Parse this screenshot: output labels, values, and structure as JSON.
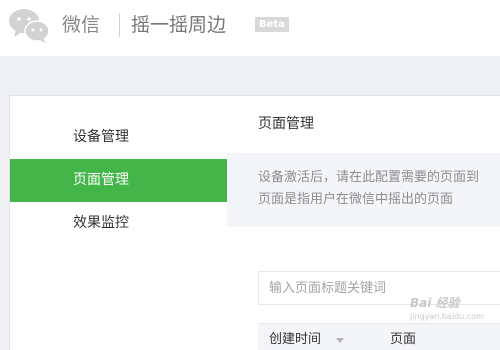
{
  "header": {
    "brand": "微信",
    "app_title": "摇一摇周边",
    "badge": "Beta"
  },
  "sidebar": {
    "items": [
      {
        "label": "设备管理",
        "active": false
      },
      {
        "label": "页面管理",
        "active": true
      },
      {
        "label": "效果监控",
        "active": false
      }
    ]
  },
  "main": {
    "title": "页面管理",
    "notice_line1": "设备激活后，请在此配置需要的页面到",
    "notice_line2": "页面是指用户在微信中摇出的页面",
    "search_placeholder": "输入页面标题关键词",
    "columns": [
      "创建时间",
      "页面"
    ]
  },
  "watermark": {
    "text": "Bai 经验",
    "sub": "jingyan.baidu.com"
  },
  "colors": {
    "accent": "#44b549",
    "header_bg": "#ffffff",
    "page_bg": "#eef0f3"
  },
  "icons": {
    "logo": "wechat-logo-icon",
    "sort": "sort-down-icon"
  }
}
